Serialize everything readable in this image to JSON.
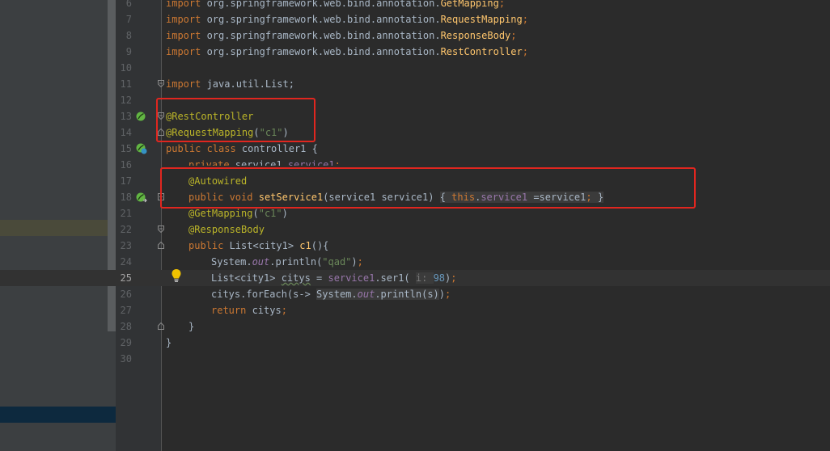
{
  "sidebar": {
    "selected_item": "",
    "active_item": ""
  },
  "code": {
    "lines": [
      {
        "num": "6",
        "top": 0
      },
      {
        "num": "7"
      },
      {
        "num": "8"
      },
      {
        "num": "9"
      },
      {
        "num": "10"
      },
      {
        "num": "11"
      },
      {
        "num": "12"
      },
      {
        "num": "13"
      },
      {
        "num": "14"
      },
      {
        "num": "15"
      },
      {
        "num": "16"
      },
      {
        "num": "17"
      },
      {
        "num": "18"
      },
      {
        "num": "21"
      },
      {
        "num": "22"
      },
      {
        "num": "23"
      },
      {
        "num": "24"
      },
      {
        "num": "25"
      },
      {
        "num": "26"
      },
      {
        "num": "27"
      },
      {
        "num": "28"
      },
      {
        "num": "29"
      },
      {
        "num": "30"
      }
    ],
    "text": {
      "kw_import": "import",
      "l6_pkg": " org.springframework.web.bind.annotation.",
      "l6_cls": "GetMapping",
      "l7_cls": "RequestMapping",
      "l8_cls": "ResponseBody",
      "l9_cls": "RestController",
      "semi": ";",
      "l11_pkg": " java.util.List;",
      "l13_anno": "@RestController",
      "l14_anno": "@RequestMapping",
      "l14_open": "(",
      "l14_str": "\"c1\"",
      "l14_close": ")",
      "l15_kw": "public class",
      "l15_rest": " controller1 {",
      "l16_kw": "private",
      "l16_type": " service1 ",
      "l16_field": "service1",
      "l16_semi": ";",
      "l17_anno": "@Autowired",
      "l18_kw": "public void",
      "l18_sp": " ",
      "l18_method": "setService1",
      "l18_params": "(service1 service1) ",
      "l18_open": "{",
      "l18_sp2": " ",
      "l18_this": "this",
      "l18_dot": ".",
      "l18_field": "service1",
      "l18_assign": " =service1",
      "l18_semi": ";",
      "l18_close": " }",
      "l21_anno": "@GetMapping",
      "l21_open": "(",
      "l21_str": "\"c1\"",
      "l21_close": ")",
      "l22_anno": "@ResponseBody",
      "l23_kw": "public",
      "l23_type": " List<city1> ",
      "l23_method": "c1",
      "l23_rest": "(){",
      "l24_a": "System.",
      "l24_out": "out",
      "l24_b": ".println(",
      "l24_str": "\"qad\"",
      "l24_c": ")",
      "l24_semi": ";",
      "l25_a": "List<city1> ",
      "l25_var": "citys",
      "l25_b": " = ",
      "l25_field": "service1",
      "l25_c": ".ser1( ",
      "l25_hint": "i: ",
      "l25_num": "98",
      "l25_d": ")",
      "l25_semi": ";",
      "l26_a": "citys.forEach(s-> ",
      "l26_b": "System.",
      "l26_out": "out",
      "l26_c": ".println(s)",
      "l26_d": ")",
      "l26_semi": ";",
      "l27_kw": "return",
      "l27_rest": " citys",
      "l27_semi": ";",
      "l28": "}",
      "l29": "}"
    }
  },
  "colors": {
    "keyword": "#cc7832",
    "annotation": "#bbb529",
    "string": "#6a8759",
    "field": "#9876aa",
    "method": "#ffc66d",
    "number": "#6897bb",
    "highlight_box": "#e0261f"
  },
  "icons": [
    "spring-bean-icon",
    "spring-mapping-icon",
    "autowired-bean-icon",
    "fold-marker-icon",
    "intention-bulb-icon"
  ]
}
